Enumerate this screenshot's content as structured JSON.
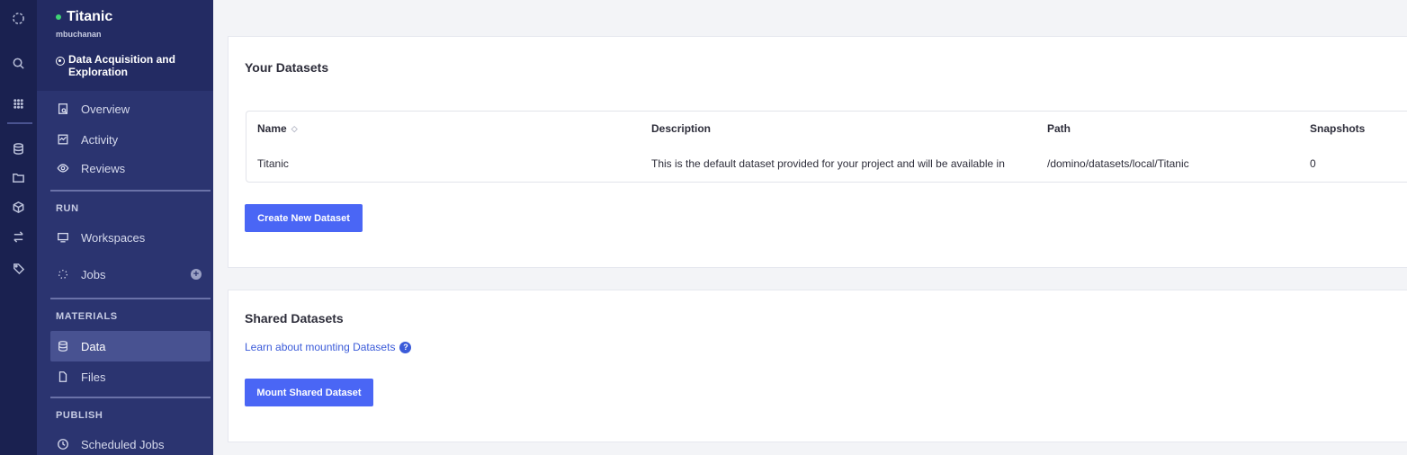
{
  "project": {
    "title": "Titanic",
    "user": "mbuchanan",
    "stage_line1": "Data Acquisition and",
    "stage_line2": "Exploration"
  },
  "rail": {
    "icons": [
      "domino-logo-icon",
      "search-icon",
      "apps-grid-icon",
      "database-icon",
      "folder-icon",
      "cube-icon",
      "transfer-icon",
      "tag-icon"
    ]
  },
  "nav": {
    "overview": "Overview",
    "activity": "Activity",
    "reviews": "Reviews",
    "run_label": "RUN",
    "workspaces": "Workspaces",
    "jobs": "Jobs",
    "jobs_add": "+",
    "materials_label": "MATERIALS",
    "data": "Data",
    "files": "Files",
    "publish_label": "PUBLISH",
    "scheduled_jobs": "Scheduled Jobs"
  },
  "your_datasets": {
    "title": "Your Datasets",
    "columns": [
      "Name",
      "Description",
      "Path",
      "Snapshots"
    ],
    "sort_glyph": "◇",
    "rows": [
      {
        "name": "Titanic",
        "description": "This is the default dataset provided for your project and will be available in",
        "path": "/domino/datasets/local/Titanic",
        "snapshots": "0"
      }
    ],
    "create_button": "Create New Dataset"
  },
  "shared_datasets": {
    "title": "Shared Datasets",
    "learn_link": "Learn about mounting Datasets",
    "help_glyph": "?",
    "mount_button": "Mount Shared Dataset"
  },
  "colors": {
    "rail_bg": "#1a2150",
    "sidebar_bg": "#2b3470",
    "active_item": "#485291",
    "primary_button": "#4a66f5",
    "status_dot": "#3ed374",
    "link": "#3b5bd9"
  }
}
